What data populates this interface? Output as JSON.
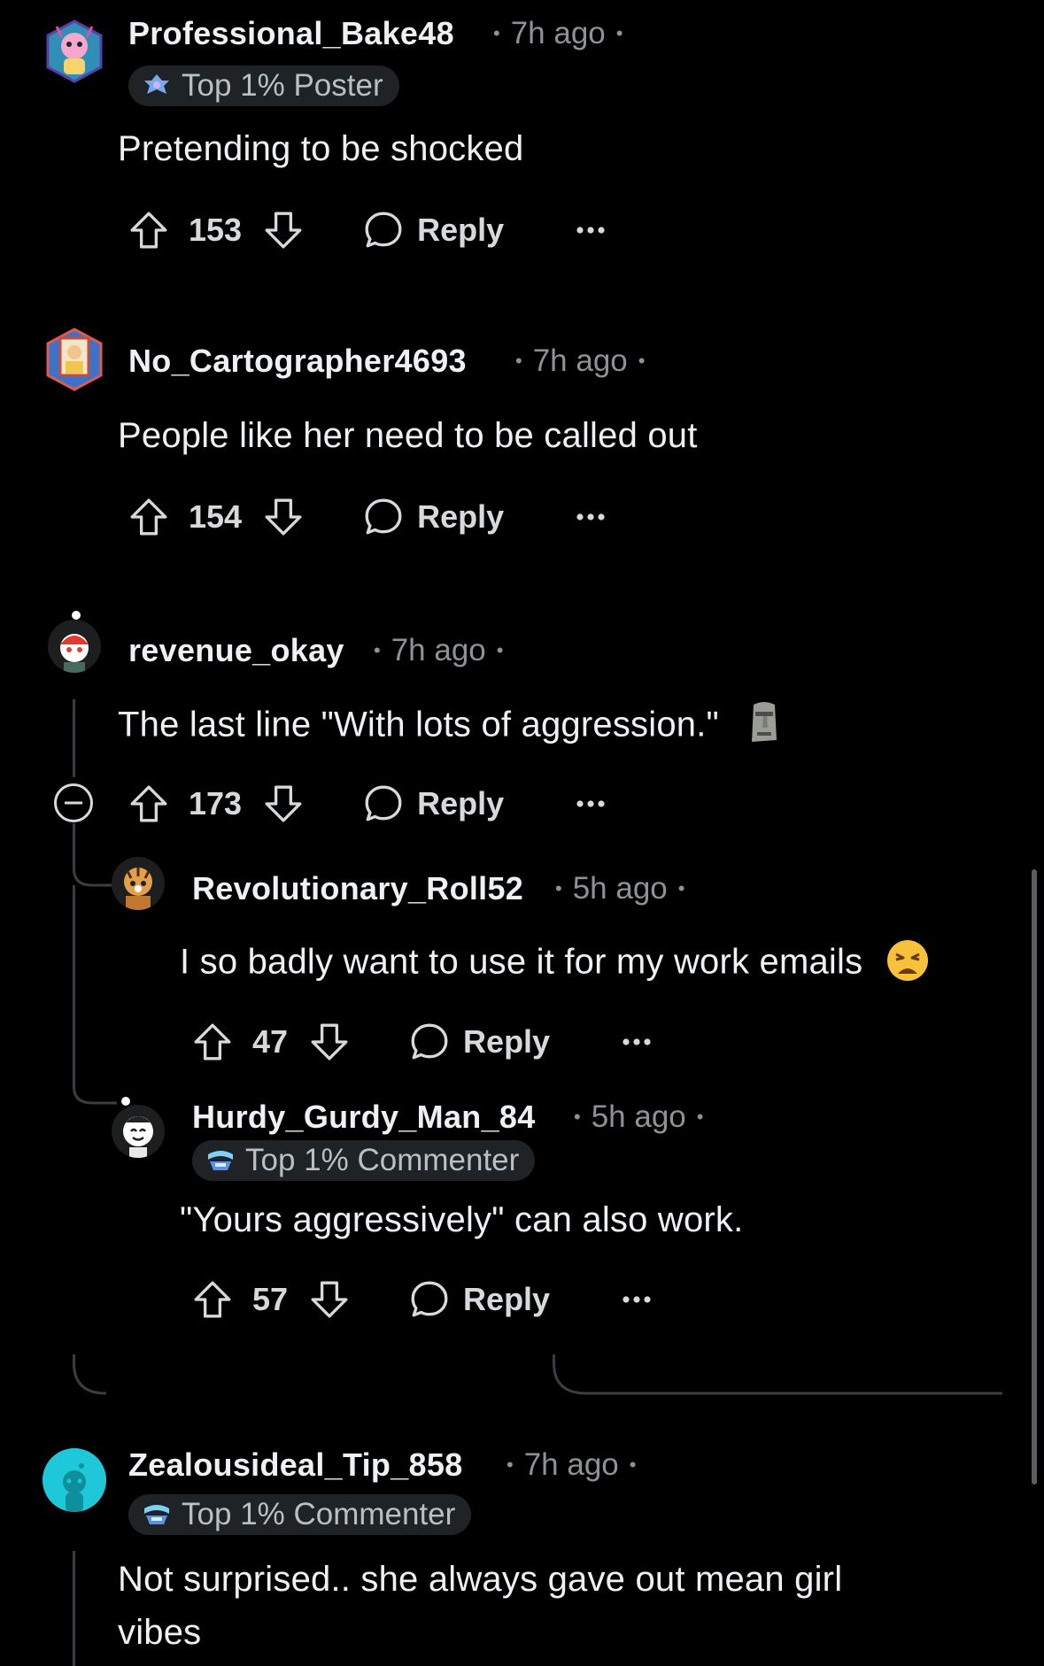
{
  "colors": {
    "background": "#000000",
    "text": "#eef1f3",
    "muted": "#8c9296",
    "flair_bg": "#1f2325",
    "thread_line": "#3a3e41"
  },
  "comments": [
    {
      "username": "Professional_Bake48",
      "time": "7h ago",
      "flair": "Top 1% Poster",
      "flair_icon": "top-poster-icon",
      "body": "Pretending to be shocked",
      "votes": "153",
      "reply_label": "Reply",
      "avatar_icon": "pink-character-hexagon-avatar"
    },
    {
      "username": "No_Cartographer4693",
      "time": "7h ago",
      "body": "People like her need to be called out",
      "votes": "154",
      "reply_label": "Reply",
      "avatar_icon": "framed-portrait-hexagon-avatar"
    },
    {
      "username": "revenue_okay",
      "time": "7h ago",
      "body": "The last line \"With lots of aggression.\"",
      "body_emoji": "moai",
      "votes": "173",
      "reply_label": "Reply",
      "avatar_icon": "snoo-red-cap-avatar",
      "collapse_icon": "collapse-minus-icon",
      "replies": [
        {
          "username": "Revolutionary_Roll52",
          "time": "5h ago",
          "body": "I so badly want to use it for my work emails",
          "body_emoji": "weary-face",
          "votes": "47",
          "reply_label": "Reply",
          "avatar_icon": "snoo-tiger-avatar"
        },
        {
          "username": "Hurdy_Gurdy_Man_84",
          "time": "5h ago",
          "flair": "Top 1% Commenter",
          "flair_icon": "top-commenter-icon",
          "body": "\"Yours aggressively\" can also work.",
          "votes": "57",
          "reply_label": "Reply",
          "avatar_icon": "snoo-white-avatar"
        }
      ]
    },
    {
      "username": "Zealousideal_Tip_858",
      "time": "7h ago",
      "flair": "Top 1% Commenter",
      "flair_icon": "top-commenter-icon",
      "body": "Not surprised.. she always gave out mean girl vibes",
      "avatar_icon": "default-snoo-cyan-avatar"
    }
  ]
}
